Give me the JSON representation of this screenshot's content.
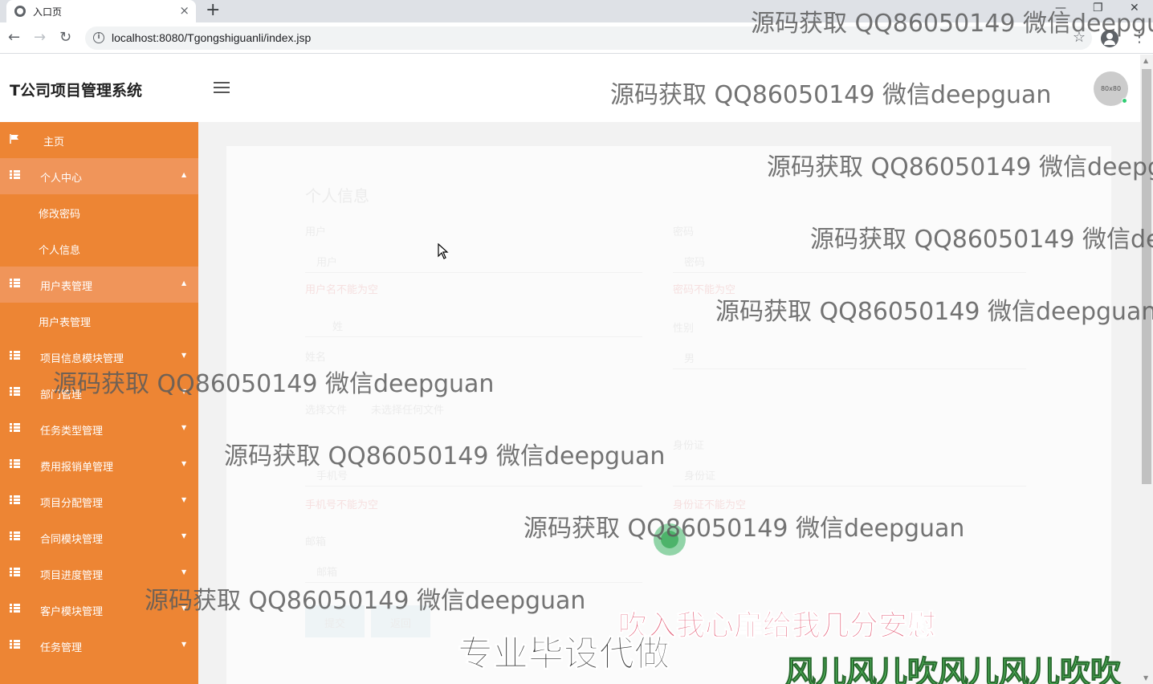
{
  "browser": {
    "tab_title": "入口页",
    "tab_close": "×",
    "new_tab": "+",
    "url": "localhost:8080/Tgongshiguanli/index.jsp",
    "win_min": "—",
    "win_max": "❐",
    "win_close": "✕"
  },
  "header": {
    "app_title": "T公司项目管理系统",
    "avatar_text": "80x80"
  },
  "sidebar": {
    "home": "主页",
    "personal": "个人中心",
    "personal_sub": [
      "修改密码",
      "个人信息"
    ],
    "users": "用户表管理",
    "users_sub": [
      "用户表管理"
    ],
    "items": [
      "项目信息模块管理",
      "部门管理",
      "任务类型管理",
      "费用报销单管理",
      "项目分配管理",
      "合同模块管理",
      "项目进度管理",
      "客户模块管理",
      "任务管理"
    ]
  },
  "form": {
    "title": "个人信息",
    "username_label": "用户",
    "username_value": "用户",
    "username_hint": "用户名不能为空",
    "password_label": "密码",
    "password_value": "密码",
    "password_hint": "密码不能为空",
    "name_label": "姓名",
    "name_value": "姓",
    "gender_label": "性别",
    "gender_value": "男",
    "avatar_label": "头像",
    "file_button": "选择文件",
    "file_status": "未选择任何文件",
    "id_label": "身份证",
    "id_value": "身份证",
    "phone_value": "手机号",
    "phone_hint": "手机号不能为空",
    "id_hint": "身份证不能为空",
    "mail_label": "邮箱",
    "mail_value": "邮箱",
    "submit": "提交",
    "back": "返回"
  },
  "overlays": {
    "watermark": "源码获取 QQ86050149 微信deepguan",
    "subtitle1": "吹入我心扉给我几分安慰",
    "subtitle2": "专业毕设代做",
    "subtitle3": "风儿风儿吹风儿风儿吹吹"
  }
}
